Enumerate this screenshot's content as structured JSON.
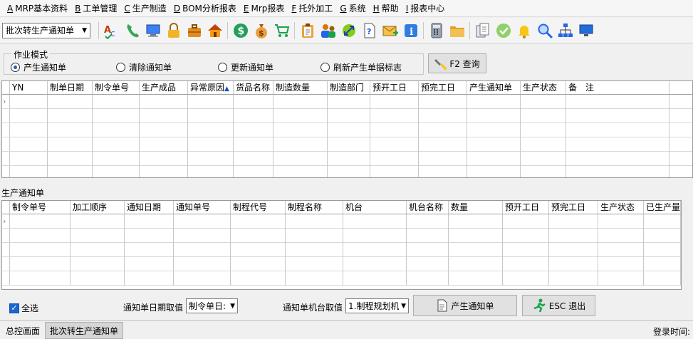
{
  "menu": [
    {
      "key": "A",
      "label": "MRP基本资料"
    },
    {
      "key": "B",
      "label": "工单管理"
    },
    {
      "key": "C",
      "label": "生产制造"
    },
    {
      "key": "D",
      "label": "BOM分析报表"
    },
    {
      "key": "E",
      "label": "Mrp报表"
    },
    {
      "key": "F",
      "label": "托外加工"
    },
    {
      "key": "G",
      "label": "系统"
    },
    {
      "key": "H",
      "label": "帮助"
    },
    {
      "key": "I",
      "label": "报表中心"
    }
  ],
  "toolbar": {
    "module_select": "批次转生产通知单"
  },
  "mode": {
    "legend": "作业模式",
    "options": [
      "产生通知单",
      "清除通知单",
      "更新通知单",
      "刷新产生单据标志"
    ],
    "selected": "产生通知单",
    "query_button": "F2 查询"
  },
  "top_grid": {
    "columns": [
      "YN",
      "制单日期",
      "制令单号",
      "生产成品",
      "异常原因",
      "货品名称",
      "制造数量",
      "制造部门",
      "预开工日",
      "预完工日",
      "产生通知单",
      "生产状态",
      "备　注"
    ],
    "sort_indicator": "▲"
  },
  "section_label": "生产通知单",
  "bottom_grid": {
    "columns": [
      "制令单号",
      "加工顺序",
      "通知日期",
      "通知单号",
      "制程代号",
      "制程名称",
      "机台",
      "机台名称",
      "数量",
      "预开工日",
      "预完工日",
      "生产状态",
      "已生产量"
    ]
  },
  "bottom": {
    "select_all": "全选",
    "date_label": "通知单日期取值",
    "date_value": "制令单日:",
    "machine_label": "通知单机台取值",
    "machine_value": "1.制程规划机",
    "generate_button": "产生通知单",
    "exit_button": "ESC 退出"
  },
  "status": {
    "tabs": [
      "总控画面",
      "批次转生产通知单"
    ],
    "active_tab": "批次转生产通知单",
    "login_label": "登录时间:"
  }
}
